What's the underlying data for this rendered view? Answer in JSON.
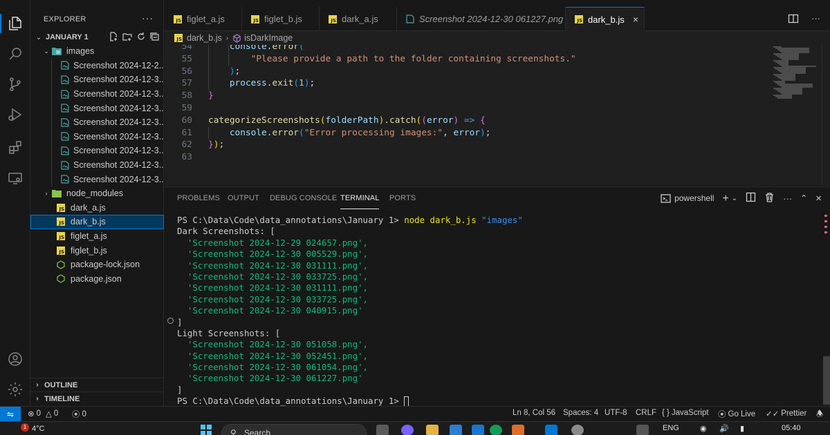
{
  "explorer": {
    "title": "EXPLORER",
    "more": "···",
    "workspace": "JANUARY 1",
    "images_folder": "images",
    "images": [
      "Screenshot 2024-12-2...",
      "Screenshot 2024-12-3...",
      "Screenshot 2024-12-3...",
      "Screenshot 2024-12-3...",
      "Screenshot 2024-12-3...",
      "Screenshot 2024-12-3...",
      "Screenshot 2024-12-3...",
      "Screenshot 2024-12-3...",
      "Screenshot 2024-12-3..."
    ],
    "node_modules": "node_modules",
    "files": [
      "dark_a.js",
      "dark_b.js",
      "figlet_a.js",
      "figlet_b.js",
      "package-lock.json",
      "package.json"
    ],
    "selected_file": "dark_b.js",
    "outline": "OUTLINE",
    "timeline": "TIMELINE"
  },
  "tabs": [
    {
      "label": "figlet_a.js",
      "type": "js"
    },
    {
      "label": "figlet_b.js",
      "type": "js"
    },
    {
      "label": "dark_a.js",
      "type": "js"
    },
    {
      "label": "Screenshot 2024-12-30 061227.png",
      "type": "image"
    },
    {
      "label": "dark_b.js",
      "type": "js",
      "active": true,
      "close": "×"
    }
  ],
  "breadcrumb": {
    "file": "dark_b.js",
    "symbol": "isDarkImage"
  },
  "editor": {
    "line_numbers": [
      "54",
      "55",
      "56",
      "57",
      "58",
      "59",
      "60",
      "61",
      "62",
      "63"
    ],
    "lines": [
      {
        "n": "54",
        "tokens": [
          [
            "plain",
            "    "
          ],
          [
            "var",
            "console"
          ],
          [
            "plain",
            "."
          ],
          [
            "fn",
            "error"
          ],
          [
            "paren2",
            "("
          ]
        ]
      },
      {
        "n": "55",
        "tokens": [
          [
            "plain",
            "        "
          ],
          [
            "str",
            "\"Please provide a path to the folder containing screenshots.\""
          ]
        ]
      },
      {
        "n": "56",
        "tokens": [
          [
            "plain",
            "    "
          ],
          [
            "paren2",
            ")"
          ],
          [
            "plain",
            ";"
          ]
        ]
      },
      {
        "n": "57",
        "tokens": [
          [
            "plain",
            "    "
          ],
          [
            "var",
            "process"
          ],
          [
            "plain",
            "."
          ],
          [
            "fn",
            "exit"
          ],
          [
            "paren2",
            "("
          ],
          [
            "num",
            "1"
          ],
          [
            "paren2",
            ")"
          ],
          [
            "plain",
            ";"
          ]
        ]
      },
      {
        "n": "58",
        "tokens": [
          [
            "paren",
            "}"
          ]
        ]
      },
      {
        "n": "59",
        "tokens": []
      },
      {
        "n": "60",
        "tokens": [
          [
            "fn",
            "categorizeScreenshots"
          ],
          [
            "brace",
            "("
          ],
          [
            "var",
            "folderPath"
          ],
          [
            "brace",
            ")"
          ],
          [
            "plain",
            "."
          ],
          [
            "fn",
            "catch"
          ],
          [
            "brace",
            "("
          ],
          [
            "paren",
            "("
          ],
          [
            "var",
            "error"
          ],
          [
            "paren",
            ")"
          ],
          [
            "plain",
            " "
          ],
          [
            "kw",
            "=>"
          ],
          [
            "plain",
            " "
          ],
          [
            "paren",
            "{"
          ]
        ]
      },
      {
        "n": "61",
        "tokens": [
          [
            "plain",
            "    "
          ],
          [
            "var",
            "console"
          ],
          [
            "plain",
            "."
          ],
          [
            "fn",
            "error"
          ],
          [
            "paren2",
            "("
          ],
          [
            "str",
            "\"Error processing images:\""
          ],
          [
            "plain",
            ", "
          ],
          [
            "var",
            "error"
          ],
          [
            "paren2",
            ")"
          ],
          [
            "plain",
            ";"
          ]
        ]
      },
      {
        "n": "62",
        "tokens": [
          [
            "paren",
            "}"
          ],
          [
            "brace",
            ")"
          ],
          [
            "plain",
            ";"
          ]
        ]
      },
      {
        "n": "63",
        "tokens": []
      }
    ]
  },
  "panel": {
    "tabs": [
      "PROBLEMS",
      "OUTPUT",
      "DEBUG CONSOLE",
      "TERMINAL",
      "PORTS"
    ],
    "active_tab": "TERMINAL",
    "shell": "powershell",
    "terminal": {
      "prompt1": "PS C:\\Data\\Code\\data_annotations\\January 1> ",
      "cmd": "node dark_b.js",
      "arg": "\"images\"",
      "dark_header": "Dark Screenshots: [",
      "dark": [
        "'Screenshot 2024-12-29 024657.png',",
        "'Screenshot 2024-12-30 005529.png',",
        "'Screenshot 2024-12-30 031111.png',",
        "'Screenshot 2024-12-30 033725.png',",
        "'Screenshot 2024-12-30 031111.png',",
        "'Screenshot 2024-12-30 033725.png',",
        "'Screenshot 2024-12-30 040915.png'"
      ],
      "close1": "]",
      "light_header": "Light Screenshots: [",
      "light": [
        "'Screenshot 2024-12-30 051058.png',",
        "'Screenshot 2024-12-30 052451.png',",
        "'Screenshot 2024-12-30 061054.png',",
        "'Screenshot 2024-12-30 061227.png'"
      ],
      "close2": "]",
      "prompt2": "PS C:\\Data\\Code\\data_annotations\\January 1> "
    }
  },
  "status": {
    "errors": "0",
    "warnings": "0",
    "ports": "0",
    "position": "Ln 8, Col 56",
    "spaces": "Spaces: 4",
    "encoding": "UTF-8",
    "eol": "CRLF",
    "language": "JavaScript",
    "golive": "Go Live",
    "prettier": "Prettier"
  },
  "taskbar": {
    "badge": "1",
    "weather": "4°C",
    "search": "Search",
    "lang": "ENG",
    "time": "05:40"
  },
  "colors": {
    "accent": "#0078d4",
    "selection": "#04395e",
    "terminal_green": "#0dbc79",
    "js_icon": "#e8d44d"
  }
}
